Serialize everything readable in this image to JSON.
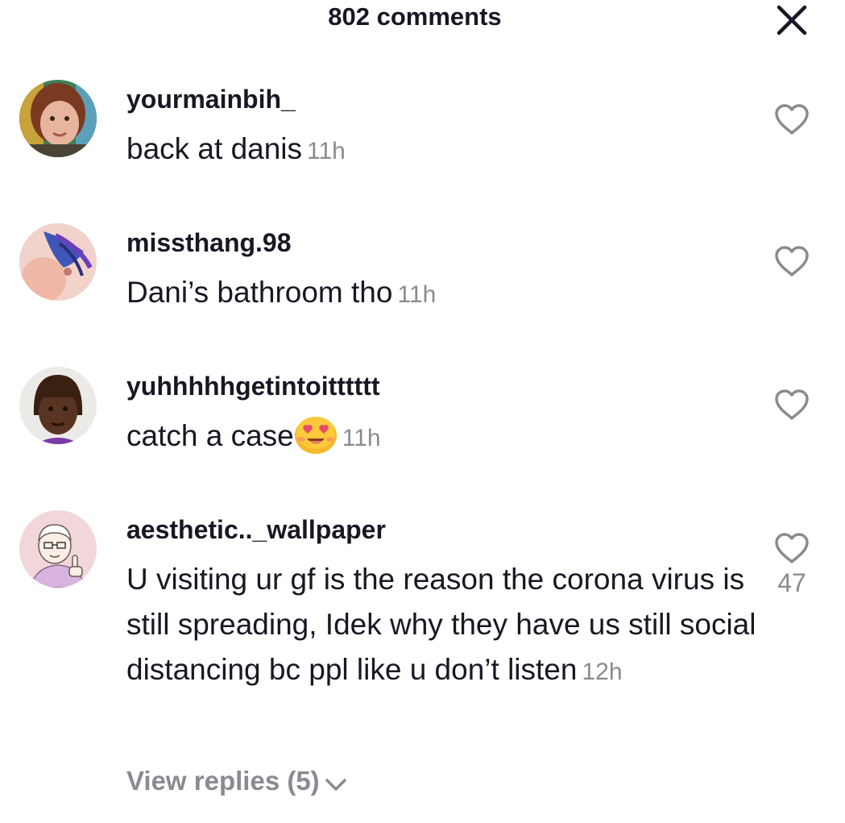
{
  "header": {
    "title": "802 comments",
    "close_icon": "close-icon"
  },
  "comments": [
    {
      "username": "yourmainbih_",
      "text": "back at danis",
      "time": "11h",
      "like_icon": "heart-outline-icon"
    },
    {
      "username": "missthang.98",
      "text": "Dani’s bathroom tho",
      "time": "11h",
      "like_icon": "heart-outline-icon"
    },
    {
      "username": "yuhhhhhgetintoitttttt",
      "text": "catch a case",
      "emoji": "smiling-face-with-heart-eyes-emoji",
      "time": "11h",
      "like_icon": "heart-outline-icon"
    },
    {
      "username": "aesthetic.._wallpaper",
      "text": "U visiting ur gf is the reason the corona virus is still spreading, Idek why they have us still social distancing bc ppl like u don’t listen",
      "time": "12h",
      "like_icon": "heart-outline-icon",
      "like_count": "47",
      "replies_label": "View replies (5)"
    }
  ],
  "colors": {
    "primary_text": "#161823",
    "secondary_text": "#8a8b91"
  }
}
